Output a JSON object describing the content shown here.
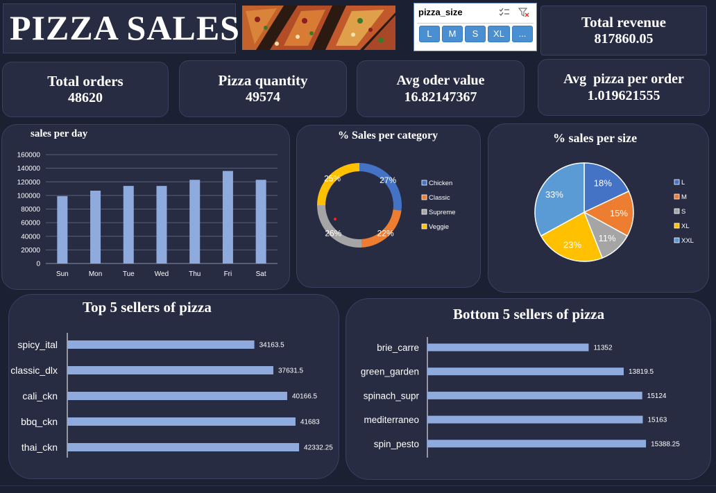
{
  "header": {
    "title": "PIZZA SALES"
  },
  "slicer": {
    "title": "pizza_size",
    "buttons": [
      "L",
      "M",
      "S",
      "XL",
      "..."
    ]
  },
  "kpis": {
    "total_revenue": {
      "label": "Total revenue",
      "value": "817860.05"
    },
    "total_orders": {
      "label": "Total orders",
      "value": "48620"
    },
    "pizza_quantity": {
      "label": "Pizza quantity",
      "value": "49574"
    },
    "avg_order_value": {
      "label": "Avg oder value",
      "value": "16.82147367"
    },
    "avg_pizza_per_order": {
      "label": "Avg  pizza per order",
      "value": "1.019621555"
    }
  },
  "chart_data": [
    {
      "type": "bar",
      "title": "sales per day",
      "categories": [
        "Sun",
        "Mon",
        "Tue",
        "Wed",
        "Thu",
        "Fri",
        "Sat"
      ],
      "values": [
        99000,
        107000,
        114000,
        114000,
        123000,
        136000,
        123000
      ],
      "ylim": [
        0,
        160000
      ],
      "yticks": [
        "0",
        "20000",
        "40000",
        "60000",
        "80000",
        "100000",
        "120000",
        "140000",
        "160000"
      ],
      "grid": true,
      "color": "#8faadc"
    },
    {
      "type": "pie",
      "title": "% Sales  per category",
      "donut": true,
      "labels": [
        "Chicken",
        "Classic",
        "Supreme",
        "Veggie"
      ],
      "values": [
        27,
        22,
        26,
        25
      ],
      "value_labels": [
        "27%",
        "22%",
        "26%",
        "25%"
      ],
      "colors": [
        "#4472c4",
        "#ed7d31",
        "#a5a5a5",
        "#ffc000"
      ],
      "legend": "right"
    },
    {
      "type": "pie",
      "title": "% sales per size",
      "labels": [
        "L",
        "M",
        "S",
        "XL",
        "XXL"
      ],
      "values": [
        18,
        15,
        11,
        23,
        33
      ],
      "value_labels": [
        "18%",
        "15%",
        "11%",
        "23%",
        "33%"
      ],
      "colors": [
        "#4472c4",
        "#ed7d31",
        "#a5a5a5",
        "#ffc000",
        "#5b9bd5"
      ],
      "legend": "right"
    },
    {
      "type": "bar",
      "orientation": "horizontal",
      "title": "Top 5 sellers of pizza",
      "categories": [
        "spicy_ital",
        "classic_dlx",
        "cali_ckn",
        "bbq_ckn",
        "thai_ckn"
      ],
      "values": [
        34163.5,
        37631.5,
        40166.5,
        41683,
        42332.25
      ],
      "value_labels": [
        "34163.5",
        "37631.5",
        "40166.5",
        "41683",
        "42332.25"
      ],
      "xlim": [
        0,
        46000
      ],
      "color": "#8faadc"
    },
    {
      "type": "bar",
      "orientation": "horizontal",
      "title": "Bottom 5 sellers of pizza",
      "categories": [
        "brie_carre",
        "green_garden",
        "spinach_supr",
        "mediterraneo",
        "spin_pesto"
      ],
      "values": [
        11352,
        13819.5,
        15124,
        15163,
        15388.25
      ],
      "value_labels": [
        "11352",
        "13819.5",
        "15124",
        "15163",
        "15388.25"
      ],
      "xlim": [
        0,
        16800
      ],
      "color": "#8faadc"
    }
  ]
}
